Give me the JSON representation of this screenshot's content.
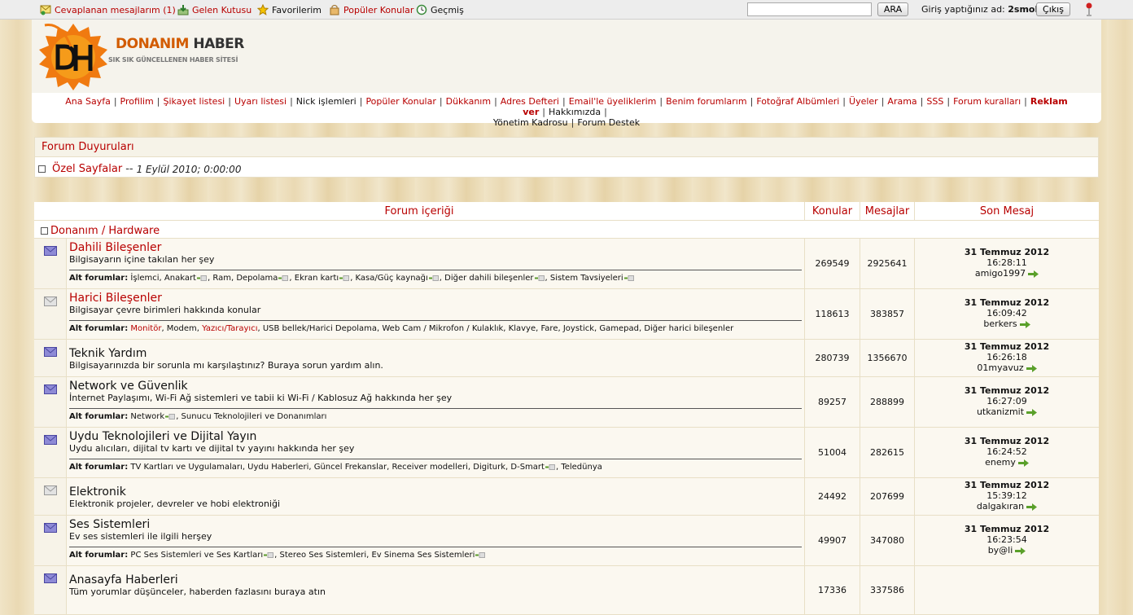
{
  "topbar": {
    "replied": "Cevaplanan mesajlarım (1)",
    "inbox": "Gelen Kutusu",
    "favorites": "Favorilerim",
    "popular": "Popüler Konular",
    "history": "Geçmiş",
    "search_button": "ARA",
    "login_prefix": "Giriş yaptığınız ad:",
    "username": "2smoke",
    "logout": "Çıkış"
  },
  "logo": {
    "brand_a": "DONANIM",
    "brand_b": "HABER",
    "tagline": "SIK SIK GÜNCELLENEN HABER SİTESİ"
  },
  "nav": [
    {
      "label": "Ana Sayfa",
      "style": "red"
    },
    {
      "label": "Profilim",
      "style": "red"
    },
    {
      "label": "Şikayet listesi",
      "style": "red"
    },
    {
      "label": "Uyarı listesi",
      "style": "red"
    },
    {
      "label": "Nick işlemleri",
      "style": "dark"
    },
    {
      "label": "Popüler Konular",
      "style": "red"
    },
    {
      "label": "Dükkanım",
      "style": "red"
    },
    {
      "label": "Adres Defteri",
      "style": "red"
    },
    {
      "label": "Email'le üyeliklerim",
      "style": "red"
    },
    {
      "label": "Benim forumlarım",
      "style": "red"
    },
    {
      "label": "Fotoğraf Albümleri",
      "style": "red"
    },
    {
      "label": "Üyeler",
      "style": "red"
    },
    {
      "label": "Arama",
      "style": "red"
    },
    {
      "label": "SSS",
      "style": "red"
    },
    {
      "label": "Forum kuralları",
      "style": "red"
    },
    {
      "label": "Reklam ver",
      "style": "bold"
    },
    {
      "label": "Hakkımızda",
      "style": "dark"
    },
    {
      "label": "Yönetim Kadrosu",
      "style": "dark"
    },
    {
      "label": "Forum Destek",
      "style": "dark"
    }
  ],
  "announcements": {
    "title": "Forum Duyuruları",
    "item_title": "Özel Sayfalar",
    "item_sep": "--",
    "item_date": "1 Eylül 2010; 0:00:00"
  },
  "table": {
    "col_content": "Forum içeriği",
    "col_topics": "Konular",
    "col_posts": "Mesajlar",
    "col_last": "Son Mesaj",
    "category": "Donanım / Hardware",
    "subforums_label": "Alt forumlar:",
    "forums": [
      {
        "title": "Dahili Bileşenler",
        "red": true,
        "unread": true,
        "desc": "Bilgisayarın içine takılan her şey",
        "subs": [
          {
            "label": "İşlemci",
            "mini": false
          },
          {
            "label": "Anakart",
            "mini": true
          },
          {
            "label": "Ram",
            "mini": false
          },
          {
            "label": "Depolama",
            "mini": true
          },
          {
            "label": "Ekran kartı",
            "mini": true
          },
          {
            "label": "Kasa/Güç kaynağı",
            "mini": true
          },
          {
            "label": "Diğer dahili bileşenler",
            "mini": true
          },
          {
            "label": "Sistem Tavsiyeleri",
            "mini": true
          }
        ],
        "topics": "269549",
        "posts": "2925641",
        "last_date": "31 Temmuz 2012",
        "last_time": "16:28:11",
        "last_user": "amigo1997"
      },
      {
        "title": "Harici Bileşenler",
        "red": true,
        "unread": false,
        "desc": "Bilgisayar çevre birimleri hakkında konular",
        "subs": [
          {
            "label": "Monitör",
            "mini": false,
            "red": true
          },
          {
            "label": "Modem",
            "mini": false
          },
          {
            "label": "Yazıcı/Tarayıcı",
            "mini": false,
            "red": true
          },
          {
            "label": "USB bellek/Harici Depolama",
            "mini": false
          },
          {
            "label": "Web Cam / Mikrofon / Kulaklık",
            "mini": false
          },
          {
            "label": "Klavye, Fare, Joystick, Gamepad",
            "mini": false
          },
          {
            "label": "Diğer harici bileşenler",
            "mini": false
          }
        ],
        "topics": "118613",
        "posts": "383857",
        "last_date": "31 Temmuz 2012",
        "last_time": "16:09:42",
        "last_user": "berkers"
      },
      {
        "title": "Teknik Yardım",
        "red": false,
        "unread": true,
        "desc": "Bilgisayarınızda bir sorunla mı karşılaştınız? Buraya sorun yardım alın.",
        "subs": [],
        "topics": "280739",
        "posts": "1356670",
        "last_date": "31 Temmuz 2012",
        "last_time": "16:26:18",
        "last_user": "01myavuz"
      },
      {
        "title": "Network ve Güvenlik",
        "red": false,
        "unread": true,
        "desc": "İnternet Paylaşımı, Wi-Fi Ağ sistemleri ve tabii ki Wi-Fi / Kablosuz Ağ hakkında her şey",
        "subs": [
          {
            "label": "Network",
            "mini": true
          },
          {
            "label": "Sunucu Teknolojileri ve Donanımları",
            "mini": false
          }
        ],
        "topics": "89257",
        "posts": "288899",
        "last_date": "31 Temmuz 2012",
        "last_time": "16:27:09",
        "last_user": "utkanizmit"
      },
      {
        "title": "Uydu Teknolojileri ve Dijital Yayın",
        "red": false,
        "unread": true,
        "desc": "Uydu alıcıları, dijital tv kartı ve dijital tv yayını hakkında her şey",
        "subs": [
          {
            "label": "TV Kartları ve Uygulamaları",
            "mini": false
          },
          {
            "label": "Uydu Haberleri",
            "mini": false
          },
          {
            "label": "Güncel Frekanslar",
            "mini": false
          },
          {
            "label": "Receiver modelleri",
            "mini": false
          },
          {
            "label": "Digiturk",
            "mini": false
          },
          {
            "label": "D-Smart",
            "mini": true
          },
          {
            "label": "Teledünya",
            "mini": false
          }
        ],
        "topics": "51004",
        "posts": "282615",
        "last_date": "31 Temmuz 2012",
        "last_time": "16:24:52",
        "last_user": "enemy"
      },
      {
        "title": "Elektronik",
        "red": false,
        "unread": false,
        "desc": "Elektronik projeler, devreler ve hobi elektroniği",
        "subs": [],
        "topics": "24492",
        "posts": "207699",
        "last_date": "31 Temmuz 2012",
        "last_time": "15:39:12",
        "last_user": "dalgakıran"
      },
      {
        "title": "Ses Sistemleri",
        "red": false,
        "unread": true,
        "desc": "Ev ses sistemleri ile ilgili herşey",
        "subs": [
          {
            "label": "PC Ses Sistemleri ve Ses Kartları",
            "mini": true
          },
          {
            "label": "Stereo Ses Sistemleri",
            "mini": false
          },
          {
            "label": "Ev Sinema Ses Sistemleri",
            "mini": true
          }
        ],
        "topics": "49907",
        "posts": "347080",
        "last_date": "31 Temmuz 2012",
        "last_time": "16:23:54",
        "last_user": "by@li"
      },
      {
        "title": "Anasayfa Haberleri",
        "red": false,
        "unread": true,
        "desc": "Tüm yorumlar düşünceler, haberden fazlasını buraya atın",
        "subs": [],
        "topics": "17336",
        "posts": "337586",
        "last_date": "",
        "last_time": "",
        "last_user": ""
      }
    ]
  }
}
